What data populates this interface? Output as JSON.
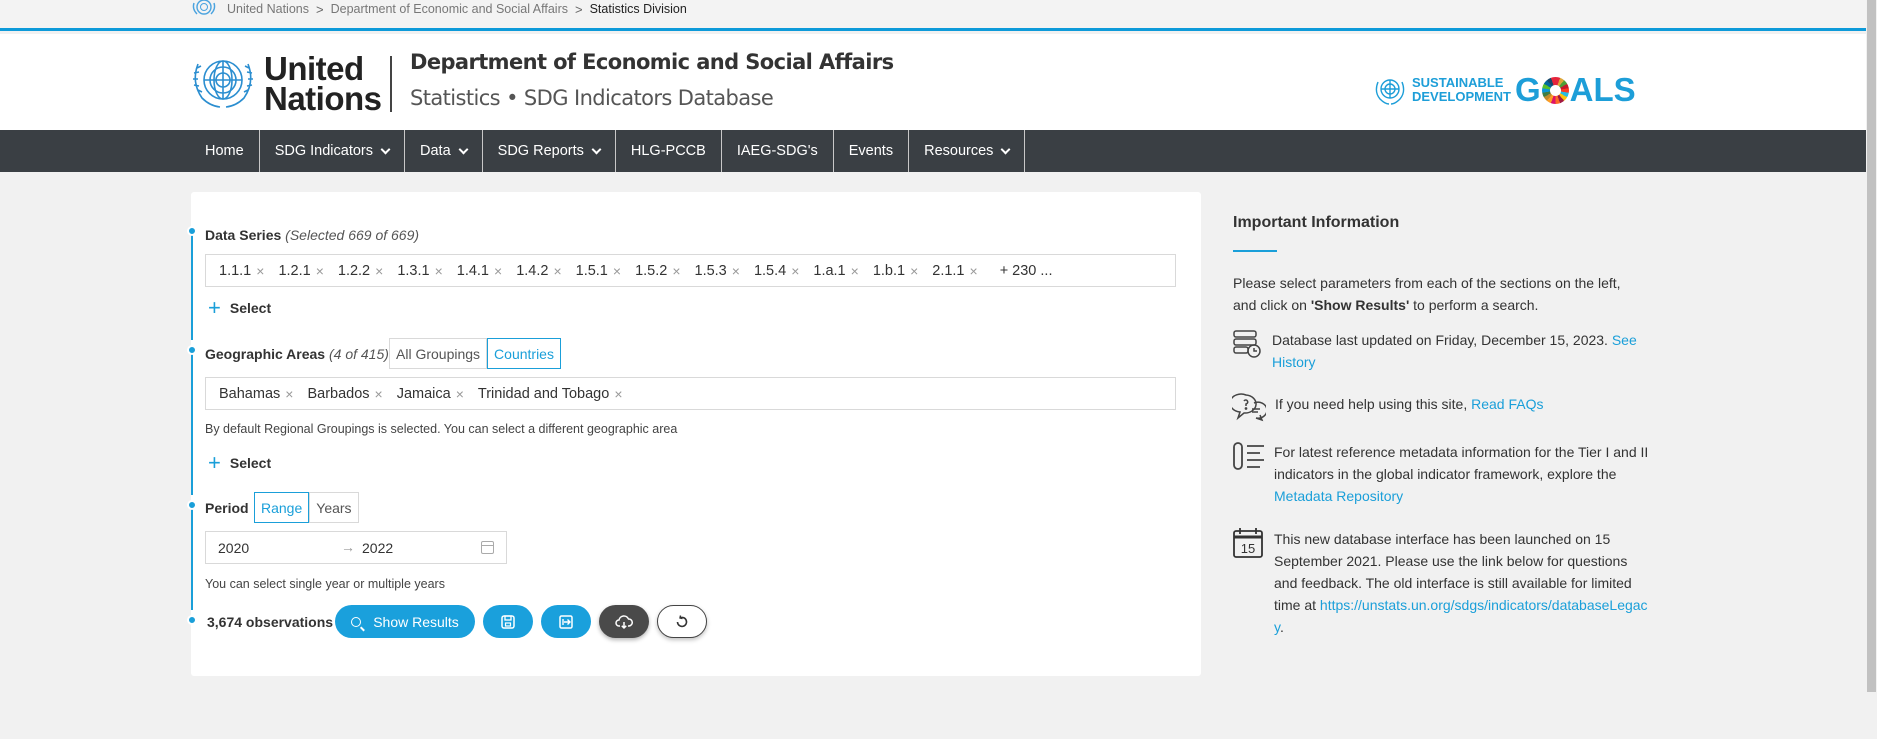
{
  "breadcrumb": {
    "items": [
      "United Nations",
      "Department of Economic and Social Affairs"
    ],
    "current": "Statistics Division",
    "separator": ">"
  },
  "header": {
    "org_line1": "United",
    "org_line2": "Nations",
    "department": "Department of Economic and Social Affairs",
    "subtitle": "Statistics • SDG Indicators Database",
    "sdg_line1": "SUSTAINABLE",
    "sdg_line2": "DEVELOPMENT",
    "sdg_goals_g": "G",
    "sdg_goals_rest": "ALS"
  },
  "nav": {
    "items": [
      {
        "label": "Home"
      },
      {
        "label": "SDG Indicators"
      },
      {
        "label": "Data"
      },
      {
        "label": "SDG Reports"
      },
      {
        "label": "HLG-PCCB"
      },
      {
        "label": "IAEG-SDG's"
      },
      {
        "label": "Events"
      },
      {
        "label": "Resources"
      }
    ]
  },
  "data_series": {
    "label": "Data Series",
    "count": "(Selected 669 of 669)",
    "tags": [
      "1.1.1",
      "1.2.1",
      "1.2.2",
      "1.3.1",
      "1.4.1",
      "1.4.2",
      "1.5.1",
      "1.5.2",
      "1.5.3",
      "1.5.4",
      "1.a.1",
      "1.b.1",
      "2.1.1"
    ],
    "more": "+ 230 ...",
    "select_label": "Select"
  },
  "geo": {
    "label": "Geographic Areas",
    "count": "(4 of 415)",
    "seg_all": "All Groupings",
    "seg_countries": "Countries",
    "tags": [
      "Bahamas",
      "Barbados",
      "Jamaica",
      "Trinidad and Tobago"
    ],
    "hint": "By default Regional Groupings is selected. You can select a different geographic area",
    "select_label": "Select"
  },
  "period": {
    "label": "Period",
    "seg_range": "Range",
    "seg_years": "Years",
    "from": "2020",
    "to": "2022",
    "arrow": "→",
    "hint": "You can select single year or multiple years"
  },
  "actions": {
    "observations": "3,674 observations",
    "show_results": "Show Results"
  },
  "info": {
    "title": "Important Information",
    "p1_a": "Please select parameters from each of the sections on the left, and click on ",
    "p1_b": "'Show Results'",
    "p1_c": " to perform a search.",
    "p2_text": "Database last updated on Friday, December 15, 2023. ",
    "p2_link": "See History",
    "p3_text": "If you need help using this site, ",
    "p3_link": "Read FAQs",
    "p4_text": "For latest reference metadata information for the Tier I and II indicators in the global indicator framework, explore the ",
    "p4_link": "Metadata Repository",
    "p5_text": "This new database interface has been launched on 15 September 2021. Please use the link below for questions and feedback. The old interface is still available for limited time at ",
    "p5_link": "https://unstats.un.org/sdgs/indicators/databaseLegacy",
    "p5_end": ".",
    "cal_day": "15"
  },
  "colors": {
    "accent": "#1a9fd9",
    "nav_bg": "#3a3f44",
    "dark_button": "#4a4a4a"
  }
}
